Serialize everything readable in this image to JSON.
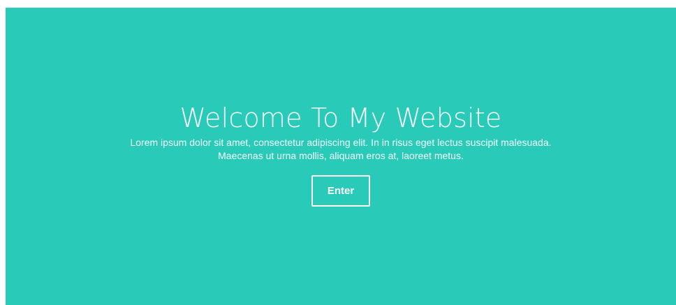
{
  "hero": {
    "title": "Welcome To My Website",
    "text": "Lorem ipsum dolor sit amet, consectetur adipiscing elit. In in risus eget lectus suscipit malesuada. Maecenas ut urna mollis, aliquam eros at, laoreet metus.",
    "button_label": "Enter"
  },
  "colors": {
    "hero_background": "#29cbb8",
    "text": "#ffffff"
  }
}
